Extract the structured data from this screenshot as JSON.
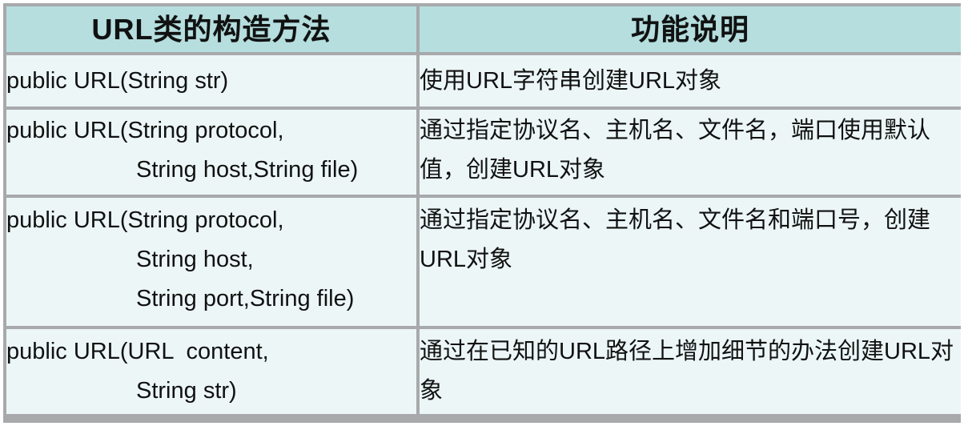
{
  "header": {
    "ctor_col": "URL类的构造方法",
    "desc_col": "功能说明"
  },
  "rows": [
    {
      "ctor_lines": [
        "public URL(String str)"
      ],
      "desc": "使用URL字符串创建URL对象"
    },
    {
      "ctor_lines": [
        "public URL(String protocol,",
        "String host,String file)"
      ],
      "desc": "通过指定协议名、主机名、文件名，端口使用默认值，创建URL对象"
    },
    {
      "ctor_lines": [
        "public URL(String protocol,",
        "String host,",
        "String port,String file)"
      ],
      "desc": "通过指定协议名、主机名、文件名和端口号，创建URL对象"
    },
    {
      "ctor_lines": [
        "public URL(URL  content,",
        "String str)"
      ],
      "desc": "通过在已知的URL路径上增加细节的办法创建URL对象"
    }
  ],
  "colors": {
    "header_bg": "#b7dede",
    "row_bg": "#ecf6f6",
    "border": "#a7a9ab"
  }
}
